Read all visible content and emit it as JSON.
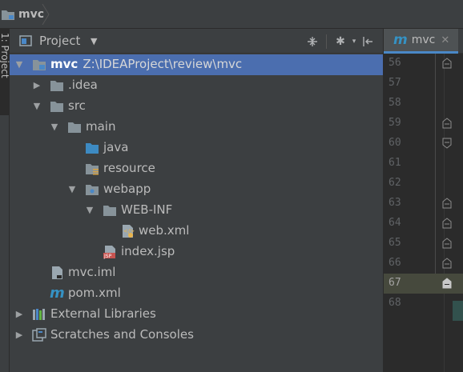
{
  "breadcrumb": {
    "label": "mvc"
  },
  "tool_stripe": {
    "label": "1: Project"
  },
  "project_panel": {
    "title": "Project",
    "tools": [
      "collapse-all-icon",
      "gear-icon",
      "hide-icon"
    ]
  },
  "tree": [
    {
      "name": "mvc",
      "path": "Z:\\IDEAProject\\review\\mvc",
      "icon": "module-folder-icon",
      "expanded": true,
      "depth": 0,
      "selected": true
    },
    {
      "name": ".idea",
      "icon": "folder-icon",
      "expanded": false,
      "depth": 1
    },
    {
      "name": "src",
      "icon": "folder-icon",
      "expanded": true,
      "depth": 1
    },
    {
      "name": "main",
      "icon": "folder-icon",
      "expanded": true,
      "depth": 2
    },
    {
      "name": "java",
      "icon": "source-folder-icon",
      "depth": 3
    },
    {
      "name": "resource",
      "icon": "resource-folder-icon",
      "depth": 3
    },
    {
      "name": "webapp",
      "icon": "web-folder-icon",
      "expanded": true,
      "depth": 3
    },
    {
      "name": "WEB-INF",
      "icon": "folder-icon",
      "expanded": true,
      "depth": 4
    },
    {
      "name": "web.xml",
      "icon": "xml-file-icon",
      "depth": 5
    },
    {
      "name": "index.jsp",
      "icon": "jsp-file-icon",
      "depth": 4
    },
    {
      "name": "mvc.iml",
      "icon": "iml-file-icon",
      "depth": 1
    },
    {
      "name": "pom.xml",
      "icon": "maven-file-icon",
      "depth": 1
    },
    {
      "name": "External Libraries",
      "icon": "library-icon",
      "expanded": false,
      "depth": 0
    },
    {
      "name": "Scratches and Consoles",
      "icon": "scratches-icon",
      "expanded": false,
      "depth": 0
    }
  ],
  "editor": {
    "tab": {
      "name": "mvc",
      "icon": "maven-m-icon"
    },
    "line_numbers": [
      "56",
      "57",
      "58",
      "59",
      "60",
      "61",
      "62",
      "63",
      "64",
      "65",
      "66",
      "67",
      "68"
    ],
    "current_line": "67"
  },
  "colors": {
    "background": "#3c3f41",
    "editor_background": "#2b2b2b",
    "selection": "#4b6eaf",
    "maven_blue": "#3592c4"
  }
}
